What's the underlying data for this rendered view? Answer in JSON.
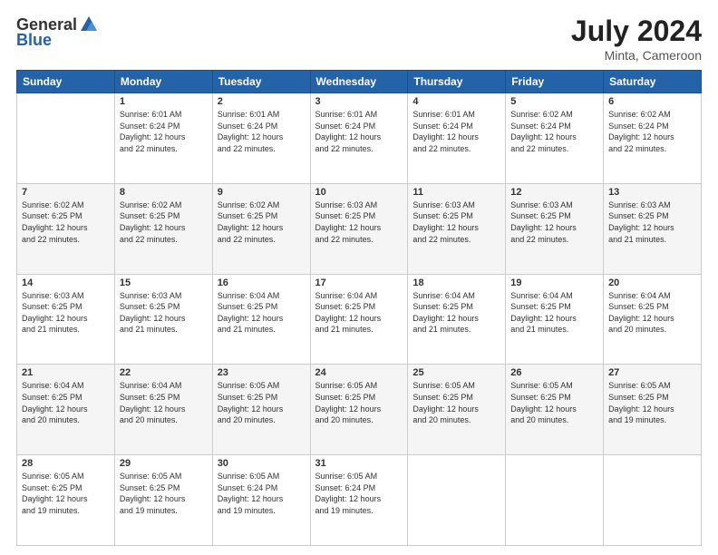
{
  "logo": {
    "general": "General",
    "blue": "Blue"
  },
  "title": "July 2024",
  "subtitle": "Minta, Cameroon",
  "headers": [
    "Sunday",
    "Monday",
    "Tuesday",
    "Wednesday",
    "Thursday",
    "Friday",
    "Saturday"
  ],
  "weeks": [
    [
      {
        "day": "",
        "info": ""
      },
      {
        "day": "1",
        "info": "Sunrise: 6:01 AM\nSunset: 6:24 PM\nDaylight: 12 hours\nand 22 minutes."
      },
      {
        "day": "2",
        "info": "Sunrise: 6:01 AM\nSunset: 6:24 PM\nDaylight: 12 hours\nand 22 minutes."
      },
      {
        "day": "3",
        "info": "Sunrise: 6:01 AM\nSunset: 6:24 PM\nDaylight: 12 hours\nand 22 minutes."
      },
      {
        "day": "4",
        "info": "Sunrise: 6:01 AM\nSunset: 6:24 PM\nDaylight: 12 hours\nand 22 minutes."
      },
      {
        "day": "5",
        "info": "Sunrise: 6:02 AM\nSunset: 6:24 PM\nDaylight: 12 hours\nand 22 minutes."
      },
      {
        "day": "6",
        "info": "Sunrise: 6:02 AM\nSunset: 6:24 PM\nDaylight: 12 hours\nand 22 minutes."
      }
    ],
    [
      {
        "day": "7",
        "info": "Sunrise: 6:02 AM\nSunset: 6:25 PM\nDaylight: 12 hours\nand 22 minutes."
      },
      {
        "day": "8",
        "info": "Sunrise: 6:02 AM\nSunset: 6:25 PM\nDaylight: 12 hours\nand 22 minutes."
      },
      {
        "day": "9",
        "info": "Sunrise: 6:02 AM\nSunset: 6:25 PM\nDaylight: 12 hours\nand 22 minutes."
      },
      {
        "day": "10",
        "info": "Sunrise: 6:03 AM\nSunset: 6:25 PM\nDaylight: 12 hours\nand 22 minutes."
      },
      {
        "day": "11",
        "info": "Sunrise: 6:03 AM\nSunset: 6:25 PM\nDaylight: 12 hours\nand 22 minutes."
      },
      {
        "day": "12",
        "info": "Sunrise: 6:03 AM\nSunset: 6:25 PM\nDaylight: 12 hours\nand 22 minutes."
      },
      {
        "day": "13",
        "info": "Sunrise: 6:03 AM\nSunset: 6:25 PM\nDaylight: 12 hours\nand 21 minutes."
      }
    ],
    [
      {
        "day": "14",
        "info": "Sunrise: 6:03 AM\nSunset: 6:25 PM\nDaylight: 12 hours\nand 21 minutes."
      },
      {
        "day": "15",
        "info": "Sunrise: 6:03 AM\nSunset: 6:25 PM\nDaylight: 12 hours\nand 21 minutes."
      },
      {
        "day": "16",
        "info": "Sunrise: 6:04 AM\nSunset: 6:25 PM\nDaylight: 12 hours\nand 21 minutes."
      },
      {
        "day": "17",
        "info": "Sunrise: 6:04 AM\nSunset: 6:25 PM\nDaylight: 12 hours\nand 21 minutes."
      },
      {
        "day": "18",
        "info": "Sunrise: 6:04 AM\nSunset: 6:25 PM\nDaylight: 12 hours\nand 21 minutes."
      },
      {
        "day": "19",
        "info": "Sunrise: 6:04 AM\nSunset: 6:25 PM\nDaylight: 12 hours\nand 21 minutes."
      },
      {
        "day": "20",
        "info": "Sunrise: 6:04 AM\nSunset: 6:25 PM\nDaylight: 12 hours\nand 20 minutes."
      }
    ],
    [
      {
        "day": "21",
        "info": "Sunrise: 6:04 AM\nSunset: 6:25 PM\nDaylight: 12 hours\nand 20 minutes."
      },
      {
        "day": "22",
        "info": "Sunrise: 6:04 AM\nSunset: 6:25 PM\nDaylight: 12 hours\nand 20 minutes."
      },
      {
        "day": "23",
        "info": "Sunrise: 6:05 AM\nSunset: 6:25 PM\nDaylight: 12 hours\nand 20 minutes."
      },
      {
        "day": "24",
        "info": "Sunrise: 6:05 AM\nSunset: 6:25 PM\nDaylight: 12 hours\nand 20 minutes."
      },
      {
        "day": "25",
        "info": "Sunrise: 6:05 AM\nSunset: 6:25 PM\nDaylight: 12 hours\nand 20 minutes."
      },
      {
        "day": "26",
        "info": "Sunrise: 6:05 AM\nSunset: 6:25 PM\nDaylight: 12 hours\nand 20 minutes."
      },
      {
        "day": "27",
        "info": "Sunrise: 6:05 AM\nSunset: 6:25 PM\nDaylight: 12 hours\nand 19 minutes."
      }
    ],
    [
      {
        "day": "28",
        "info": "Sunrise: 6:05 AM\nSunset: 6:25 PM\nDaylight: 12 hours\nand 19 minutes."
      },
      {
        "day": "29",
        "info": "Sunrise: 6:05 AM\nSunset: 6:25 PM\nDaylight: 12 hours\nand 19 minutes."
      },
      {
        "day": "30",
        "info": "Sunrise: 6:05 AM\nSunset: 6:24 PM\nDaylight: 12 hours\nand 19 minutes."
      },
      {
        "day": "31",
        "info": "Sunrise: 6:05 AM\nSunset: 6:24 PM\nDaylight: 12 hours\nand 19 minutes."
      },
      {
        "day": "",
        "info": ""
      },
      {
        "day": "",
        "info": ""
      },
      {
        "day": "",
        "info": ""
      }
    ]
  ]
}
